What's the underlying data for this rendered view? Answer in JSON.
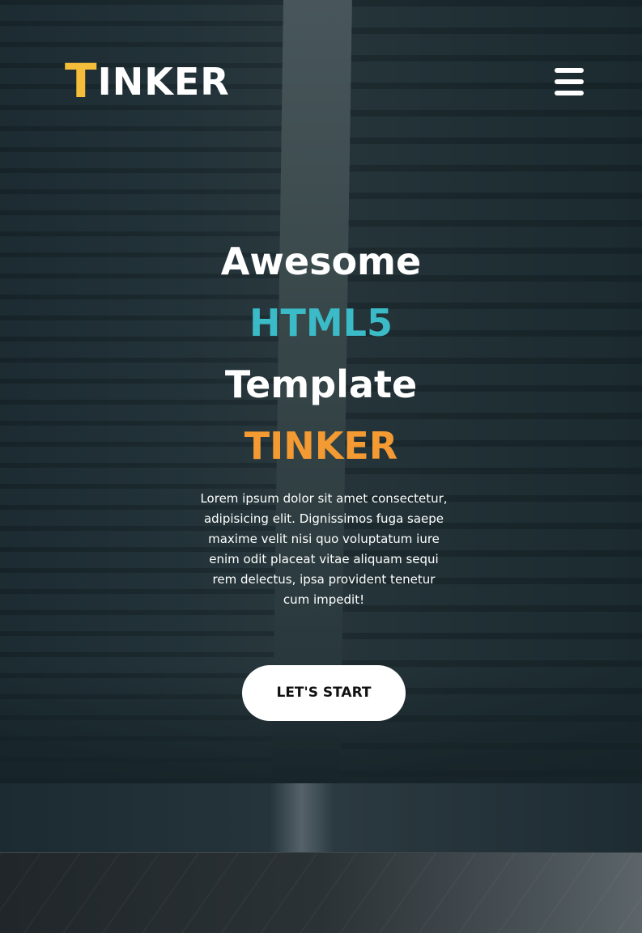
{
  "header": {
    "logo_first": "T",
    "logo_rest": "INKER",
    "menu_icon": "hamburger-menu-icon"
  },
  "hero": {
    "line1": "Awesome",
    "line2": "HTML5",
    "line3": "Template",
    "line4": "TINKER",
    "description": "Lorem ipsum dolor sit amet consectetur, adipisicing elit. Dignissimos fuga saepe maxime velit nisi quo voluptatum iure enim odit placeat vitae aliquam sequi rem delectus, ipsa provident tenetur cum impedit!",
    "cta_label": "LET'S START"
  },
  "colors": {
    "logo_accent": "#f5bd39",
    "html5_accent": "#3bbac8",
    "tinker_accent": "#f39a33",
    "button_bg": "#ffffff"
  }
}
